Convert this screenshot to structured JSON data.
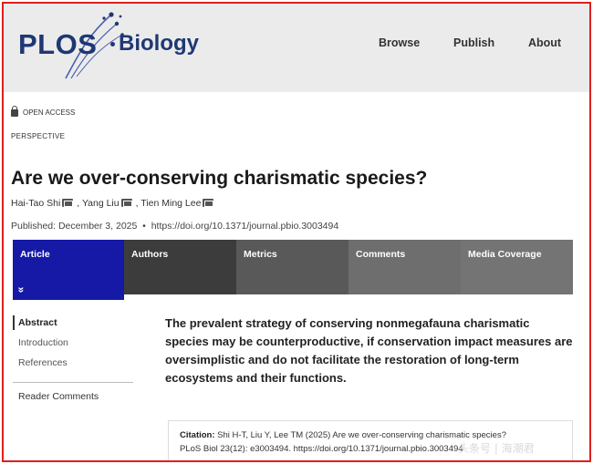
{
  "header": {
    "logo_plos": "PLOS",
    "logo_journal": "Biology",
    "nav": [
      "Browse",
      "Publish",
      "About"
    ]
  },
  "article": {
    "access_label": "OPEN ACCESS",
    "type_label": "PERSPECTIVE",
    "title": "Are we over-conserving charismatic species?",
    "authors": [
      "Hai-Tao Shi",
      "Yang Liu",
      "Tien Ming Lee"
    ],
    "published": "Published: December 3, 2025",
    "doi": "https://doi.org/10.1371/journal.pbio.3003494"
  },
  "tabs": [
    "Article",
    "Authors",
    "Metrics",
    "Comments",
    "Media Coverage"
  ],
  "tab_chevron": "»",
  "sidebar": {
    "items": [
      "Abstract",
      "Introduction",
      "References"
    ],
    "comments": "Reader Comments"
  },
  "abstract_text": "The prevalent strategy of conserving nonmegafauna charismatic species may be counterproductive, if conservation impact measures are oversimplistic and do not facilitate the restoration of long-term ecosystems and their functions.",
  "citation": {
    "label": "Citation:",
    "line1": "Shi H-T, Liu Y, Lee TM (2025) Are we over-conserving charismatic species?",
    "line2": "PLoS Biol 23(12): e3003494. https://doi.org/10.1371/journal.pbio.3003494"
  },
  "watermark": "头条号 | 海潮君",
  "colors": {
    "brand": "#1f3873",
    "active_tab": "#1519a6",
    "frame": "#e01e1e"
  }
}
